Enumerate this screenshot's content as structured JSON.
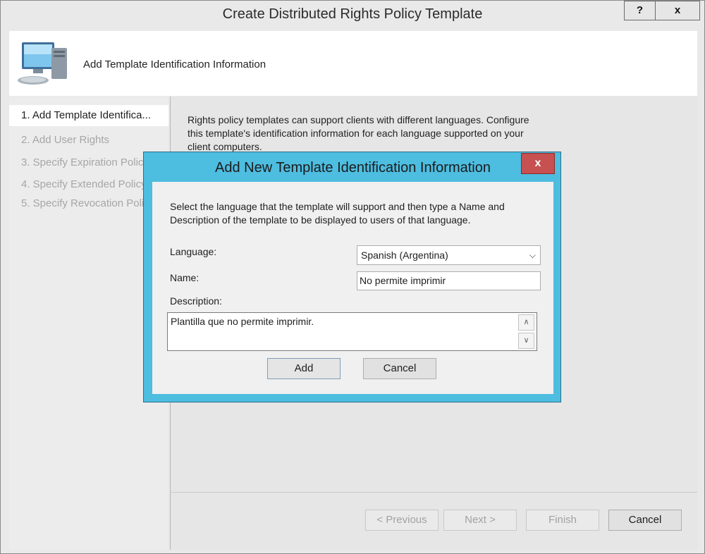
{
  "window": {
    "title": "Create Distributed Rights Policy Template",
    "help_label": "?",
    "close_label": "x"
  },
  "header": {
    "text": "Add Template Identification Information"
  },
  "steps": [
    {
      "label": "1. Add Template Identifica...",
      "active": true
    },
    {
      "label": "2. Add User Rights",
      "active": false
    },
    {
      "label": "3. Specify Expiration Policy",
      "active": false
    },
    {
      "label": "4. Specify Extended Policy",
      "active": false
    },
    {
      "label": "5. Specify Revocation Policy",
      "active": false
    }
  ],
  "main": {
    "intro": "Rights policy templates can support clients with different languages. Configure this template's identification information for each language supported on your client computers."
  },
  "footer": {
    "previous_label": "< Previous",
    "next_label": "Next >",
    "finish_label": "Finish",
    "cancel_label": "Cancel"
  },
  "dialog": {
    "title": "Add New Template Identification Information",
    "close_label": "x",
    "intro": "Select the language that the template will support and then type a Name and Description of the template to be displayed to users of that language.",
    "language_label": "Language:",
    "language_value": "Spanish (Argentina)",
    "name_label": "Name:",
    "name_value": "No permite imprimir",
    "description_label": "Description:",
    "description_value": "Plantilla que no permite imprimir.",
    "add_label": "Add",
    "cancel_label": "Cancel"
  },
  "colors": {
    "dialog_border": "#4dbde0",
    "close_red": "#c75050"
  },
  "icons": [
    "computer-icon",
    "chevron-down-icon",
    "scroll-up-icon",
    "scroll-down-icon"
  ]
}
